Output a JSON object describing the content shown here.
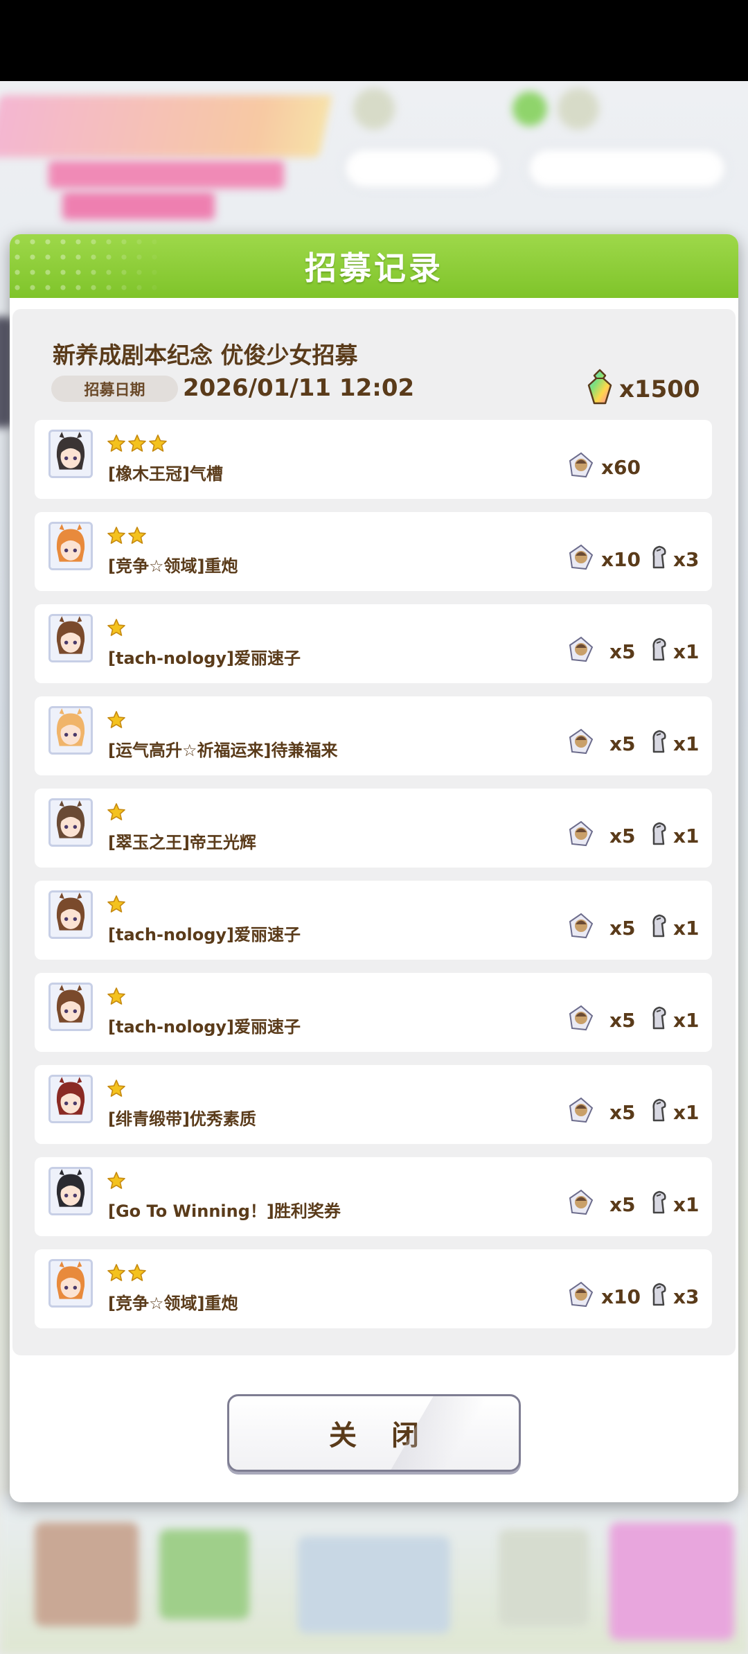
{
  "dialog": {
    "title": "招募记录",
    "gacha_name": "新养成剧本纪念 优俊少女招募",
    "date_label": "招募日期",
    "date_value": "2026/01/11 12:02",
    "cost_icon": "carat-gem-icon",
    "cost": "x1500",
    "close_label": "关 闭"
  },
  "colors": {
    "header_green": "#8ccf38",
    "text_brown": "#5a3b1a",
    "star_gold": "#f4c21e"
  },
  "results": [
    {
      "stars": 3,
      "name": "[橡木王冠]气槽",
      "pieces": "x60",
      "horseshoes": null
    },
    {
      "stars": 2,
      "name": "[竞争☆领域]重炮",
      "pieces": "x10",
      "horseshoes": "x3"
    },
    {
      "stars": 1,
      "name": "[tach-nology]爱丽速子",
      "pieces": "x5",
      "horseshoes": "x1"
    },
    {
      "stars": 1,
      "name": "[运气高升☆祈福运来]待兼福来",
      "pieces": "x5",
      "horseshoes": "x1"
    },
    {
      "stars": 1,
      "name": "[翠玉之王]帝王光辉",
      "pieces": "x5",
      "horseshoes": "x1"
    },
    {
      "stars": 1,
      "name": "[tach-nology]爱丽速子",
      "pieces": "x5",
      "horseshoes": "x1"
    },
    {
      "stars": 1,
      "name": "[tach-nology]爱丽速子",
      "pieces": "x5",
      "horseshoes": "x1"
    },
    {
      "stars": 1,
      "name": "[绯青缎带]优秀素质",
      "pieces": "x5",
      "horseshoes": "x1"
    },
    {
      "stars": 1,
      "name": "[Go To Winning！]胜利奖券",
      "pieces": "x5",
      "horseshoes": "x1"
    },
    {
      "stars": 2,
      "name": "[竞争☆领域]重炮",
      "pieces": "x10",
      "horseshoes": "x3"
    }
  ],
  "avatar_hair_colors": [
    "#3b3434",
    "#e88a3c",
    "#7a4a2c",
    "#f0b46a",
    "#6a4a34",
    "#7a4a2c",
    "#7a4a2c",
    "#8a2a24",
    "#2a2a30",
    "#e88a3c"
  ]
}
